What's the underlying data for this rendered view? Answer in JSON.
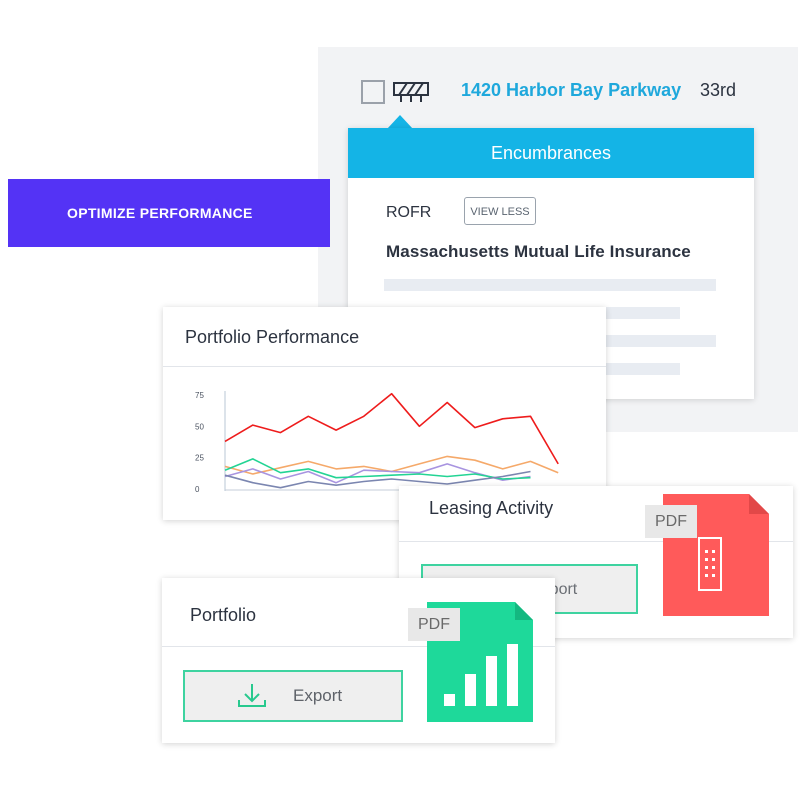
{
  "property": {
    "address": "1420 Harbor Bay Parkway",
    "floor": "33rd"
  },
  "encumbrances": {
    "title": "Encumbrances",
    "type": "ROFR",
    "toggle_label": "VIEW LESS",
    "holder": "Massachusetts Mutual Life Insurance"
  },
  "banner": {
    "text": "OPTIMIZE PERFORMANCE",
    "color": "#5433F5"
  },
  "portfolio_performance": {
    "title": "Portfolio Performance"
  },
  "chart_data": {
    "type": "line",
    "ylim": [
      0,
      75
    ],
    "yticks": [
      "0",
      "25",
      "50",
      "75"
    ],
    "x": [
      0,
      1,
      2,
      3,
      4,
      5,
      6,
      7,
      8,
      9,
      10,
      11,
      12,
      13
    ],
    "series": [
      {
        "color": "#ee1c1c",
        "values": [
          38,
          51,
          45,
          58,
          47,
          58,
          76,
          50,
          69,
          49,
          56,
          58,
          20,
          null
        ]
      },
      {
        "color": "#f5a96a",
        "values": [
          18,
          12,
          17,
          22,
          16,
          18,
          14,
          20,
          26,
          23,
          16,
          22,
          13,
          null
        ]
      },
      {
        "color": "#a894e0",
        "values": [
          10,
          16,
          8,
          14,
          5,
          15,
          14,
          13,
          20,
          13,
          7,
          10,
          null,
          null
        ]
      },
      {
        "color": "#23d494",
        "values": [
          15,
          24,
          13,
          16,
          9,
          10,
          11,
          12,
          10,
          12,
          8,
          9,
          null,
          null
        ]
      },
      {
        "color": "#7b86b0",
        "values": [
          11,
          5,
          1,
          6,
          3,
          6,
          8,
          6,
          4,
          7,
          10,
          14,
          null,
          null
        ]
      }
    ]
  },
  "leasing_activity": {
    "title": "Leasing Activity",
    "export_label": "Export",
    "file_tag": "PDF"
  },
  "portfolio": {
    "title": "Portfolio",
    "export_label": "Export",
    "file_tag": "PDF"
  },
  "colors": {
    "accent_blue": "#14B4E6",
    "export_border": "#3ED3A0",
    "pdf_red": "#FF5A5A",
    "pdf_green": "#1ED99A"
  }
}
